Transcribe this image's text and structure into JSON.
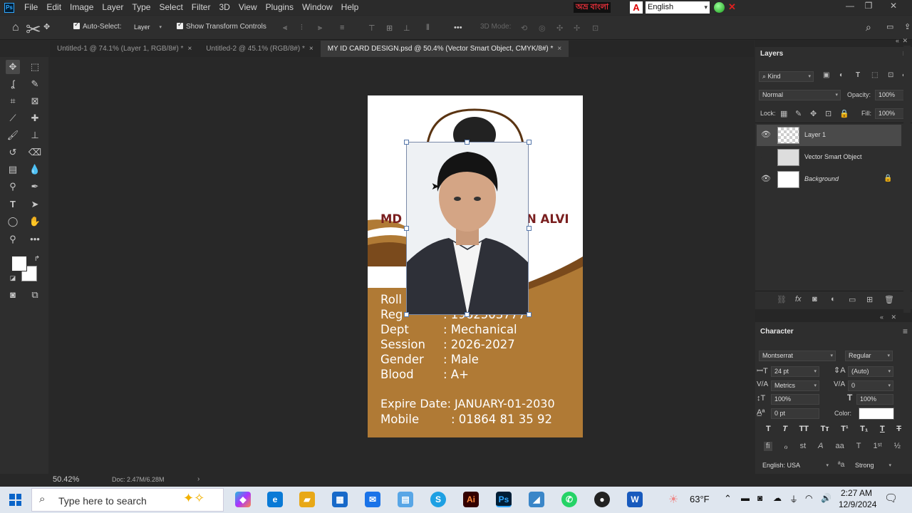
{
  "menubar": {
    "logo": "Ps",
    "items": [
      "File",
      "Edit",
      "Image",
      "Layer",
      "Type",
      "Select",
      "Filter",
      "3D",
      "View",
      "Plugins",
      "Window",
      "Help"
    ],
    "bn_label": "অভ্র বাংলা",
    "language": "English"
  },
  "options": {
    "auto_select": "Auto-Select:",
    "layer_select": "Layer",
    "show_transform": "Show Transform Controls",
    "mode_3d": "3D Mode:"
  },
  "tabs": [
    {
      "label": "Untitled-1 @ 74.1% (Layer 1, RGB/8#) *"
    },
    {
      "label": "Untitled-2 @ 45.1% (RGB/8#) *"
    },
    {
      "label": "MY ID CARD DESIGN.psd @ 50.4% (Vector Smart Object, CMYK/8#) *"
    }
  ],
  "idcard": {
    "name_left": "MD",
    "name_right": "N ALVI",
    "rows": [
      {
        "label": "Roll",
        "value": ""
      },
      {
        "label": "Reg",
        "value": ": 1962503777"
      },
      {
        "label": "Dept",
        "value": ": Mechanical"
      },
      {
        "label": "Session",
        "value": ": 2026-2027"
      },
      {
        "label": "Gender",
        "value": ": Male"
      },
      {
        "label": "Blood",
        "value": ": A+"
      }
    ],
    "expire": "Expire Date: JANUARY-01-2030",
    "mobile_label": "Mobile",
    "mobile_value": ": 01864 81 35 92",
    "brown": "#b07a35"
  },
  "status": {
    "zoom": "50.42%",
    "doc": "Doc: 2.47M/6.28M"
  },
  "layers": {
    "title": "Layers",
    "kind": "Kind",
    "blend": "Normal",
    "opacity_label": "Opacity:",
    "opacity": "100%",
    "lock_label": "Lock:",
    "fill_label": "Fill:",
    "fill": "100%",
    "items": [
      {
        "name": "Layer 1",
        "visible": true,
        "selected": true
      },
      {
        "name": "Vector Smart Object",
        "visible": false,
        "selected": false
      },
      {
        "name": "Background",
        "visible": true,
        "selected": false
      }
    ]
  },
  "character": {
    "title": "Character",
    "font": "Montserrat",
    "style": "Regular",
    "size": "24 pt",
    "leading": "(Auto)",
    "kerning": "Metrics",
    "tracking": "0",
    "vscale": "100%",
    "hscale": "100%",
    "baseline": "0 pt",
    "color_label": "Color:",
    "language": "English: USA",
    "aa": "Strong"
  },
  "taskbar": {
    "search_placeholder": "Type here to search",
    "weather": "63°F",
    "time": "2:27 AM",
    "date": "12/9/2024"
  }
}
